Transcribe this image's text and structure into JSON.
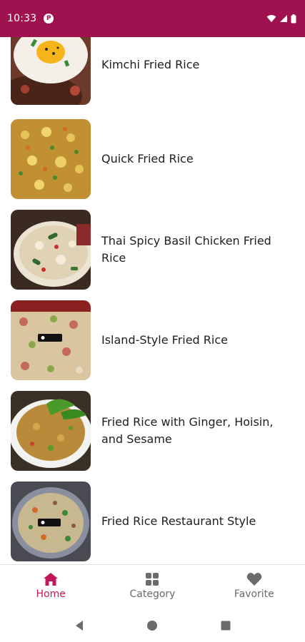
{
  "status_bar": {
    "time": "10:33",
    "background": "#a0124f"
  },
  "recipes": [
    {
      "title": "Kimchi Fried Rice",
      "image": "kimchi-fried-rice-photo"
    },
    {
      "title": "Quick Fried Rice",
      "image": "quick-fried-rice-photo"
    },
    {
      "title": "Thai Spicy Basil Chicken Fried Rice",
      "image": "thai-basil-fried-rice-photo"
    },
    {
      "title": "Island-Style Fried Rice",
      "image": "island-style-fried-rice-photo"
    },
    {
      "title": "Fried Rice with Ginger, Hoisin, and Sesame",
      "image": "ginger-hoisin-fried-rice-photo"
    },
    {
      "title": "Fried Rice Restaurant Style",
      "image": "restaurant-style-fried-rice-photo"
    }
  ],
  "bottom_nav": {
    "items": [
      {
        "label": "Home",
        "icon": "home-icon",
        "active": true
      },
      {
        "label": "Category",
        "icon": "grid-icon",
        "active": false
      },
      {
        "label": "Favorite",
        "icon": "heart-icon",
        "active": false
      }
    ],
    "active_color": "#c2185b",
    "inactive_color": "#6b6b6b"
  },
  "system_nav": {
    "buttons": [
      "back-icon",
      "home-circle-icon",
      "recents-icon"
    ]
  }
}
